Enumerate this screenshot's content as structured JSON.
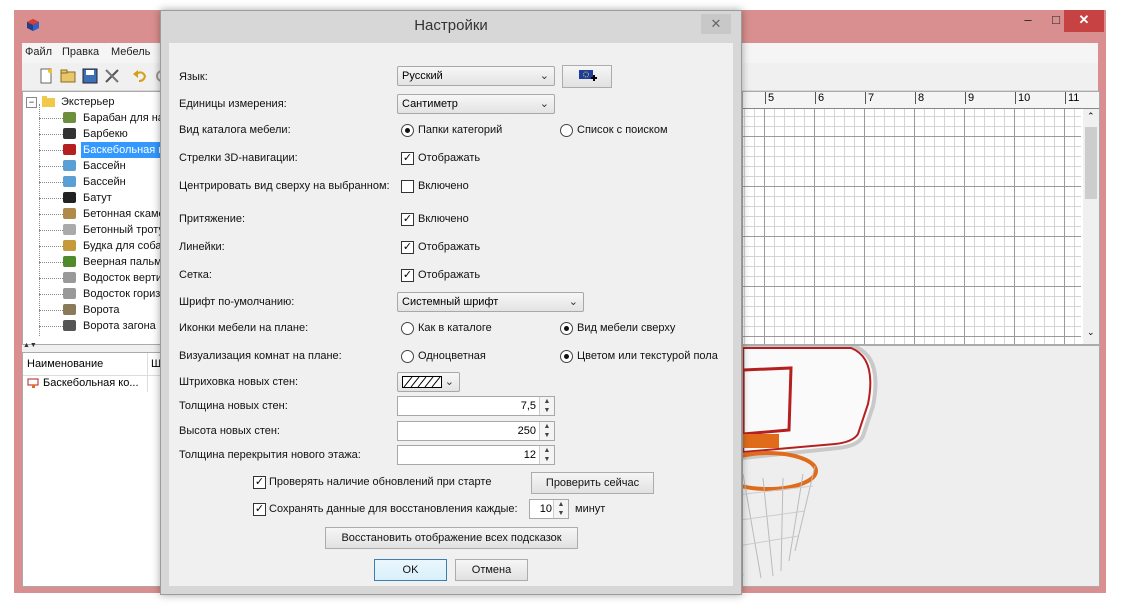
{
  "app": {
    "menu": [
      "Файл",
      "Правка",
      "Мебель"
    ],
    "window_buttons": {
      "minimize": "–",
      "maximize": "□",
      "close": "✕"
    }
  },
  "tree": {
    "root": "Экстерьер",
    "items": [
      {
        "label": "Барабан для на",
        "icon": "barrel-icon"
      },
      {
        "label": "Барбекю",
        "icon": "grill-icon"
      },
      {
        "label": "Баскебольная к",
        "icon": "basketball-hoop-icon",
        "selected": true
      },
      {
        "label": "Бассейн",
        "icon": "pool-icon"
      },
      {
        "label": "Бассейн",
        "icon": "pool-icon"
      },
      {
        "label": "Батут",
        "icon": "trampoline-icon"
      },
      {
        "label": "Бетонная скаме",
        "icon": "bench-icon"
      },
      {
        "label": "Бетонный троту",
        "icon": "sidewalk-icon"
      },
      {
        "label": "Будка для соба",
        "icon": "doghouse-icon"
      },
      {
        "label": "Веерная пальма",
        "icon": "palm-icon"
      },
      {
        "label": "Водосток верти",
        "icon": "drainpipe-icon"
      },
      {
        "label": "Водосток гориз",
        "icon": "drainpipe-icon"
      },
      {
        "label": "Ворота",
        "icon": "gate-icon"
      },
      {
        "label": "Ворота загона",
        "icon": "fence-gate-icon"
      }
    ]
  },
  "table": {
    "columns": [
      "Наименование",
      "Ш"
    ],
    "rows": [
      [
        "Баскебольная ко...",
        ""
      ]
    ]
  },
  "ruler": [
    "5",
    "6",
    "7",
    "8",
    "9",
    "10",
    "11"
  ],
  "dialog": {
    "title": "Настройки",
    "close": "✕",
    "language": {
      "label": "Язык:",
      "value": "Русский"
    },
    "units": {
      "label": "Единицы измерения:",
      "value": "Сантиметр"
    },
    "catalog_view": {
      "label": "Вид каталога мебели:",
      "opt1": "Папки категорий",
      "opt2": "Список с поиском",
      "selected": 1
    },
    "nav_arrows": {
      "label": "Стрелки 3D-навигации:",
      "option": "Отображать",
      "checked": true
    },
    "center_view": {
      "label": "Центрировать вид сверху на выбранном:",
      "option": "Включено",
      "checked": false
    },
    "magnetism": {
      "label": "Притяжение:",
      "option": "Включено",
      "checked": true
    },
    "rulers": {
      "label": "Линейки:",
      "option": "Отображать",
      "checked": true
    },
    "grid": {
      "label": "Сетка:",
      "option": "Отображать",
      "checked": true
    },
    "default_font": {
      "label": "Шрифт по-умолчанию:",
      "value": "Системный шрифт"
    },
    "furniture_icons": {
      "label": "Иконки мебели на плане:",
      "opt1": "Как в каталоге",
      "opt2": "Вид мебели сверху",
      "selected": 2
    },
    "room_render": {
      "label": "Визуализация комнат на плане:",
      "opt1": "Одноцветная",
      "opt2": "Цветом или текстурой пола",
      "selected": 2
    },
    "wall_pattern": {
      "label": "Штриховка новых стен:"
    },
    "wall_thickness": {
      "label": "Толщина новых стен:",
      "value": "7,5"
    },
    "wall_height": {
      "label": "Высота новых стен:",
      "value": "250"
    },
    "floor_thickness": {
      "label": "Толщина перекрытия нового этажа:",
      "value": "12"
    },
    "check_updates": {
      "label": "Проверять наличие обновлений при старте",
      "checked": true,
      "button": "Проверить сейчас"
    },
    "autosave": {
      "label": "Сохранять данные для восстановления каждые:",
      "checked": true,
      "value": "10",
      "unit": "минут"
    },
    "restore_tips": "Восстановить отображение всех подсказок",
    "ok": "OK",
    "cancel": "Отмена"
  },
  "colors": {
    "window_frame": "#d98f8f",
    "close_button": "#c74343",
    "selection": "#3399ff",
    "hoop_red": "#b51f1f"
  }
}
